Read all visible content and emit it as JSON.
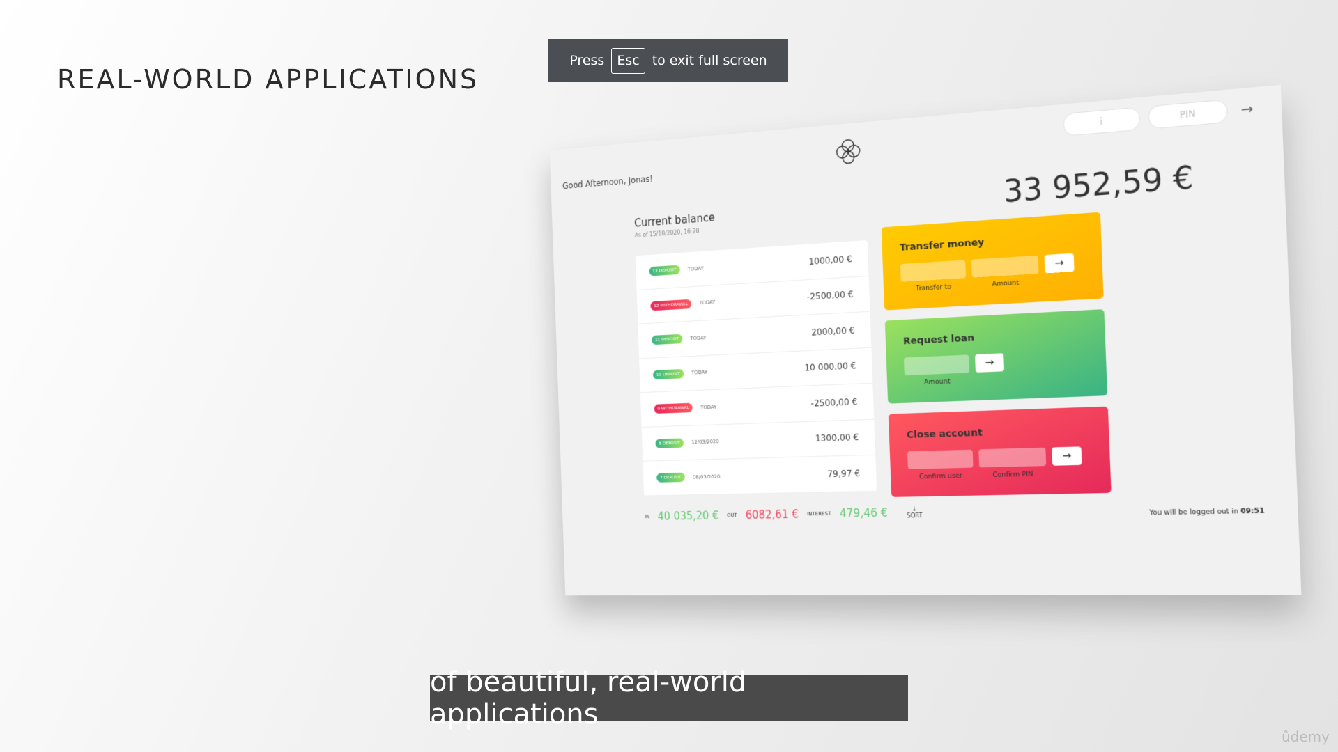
{
  "slide": {
    "title": "REAL-WORLD APPLICATIONS"
  },
  "fullscreen_notice": {
    "press": "Press",
    "key": "Esc",
    "rest": "to exit full screen"
  },
  "app": {
    "greeting": "Good Afternoon, Jonas!",
    "login": {
      "user_placeholder": "i",
      "pin_placeholder": "PIN",
      "arrow": "→"
    },
    "balance": {
      "label": "Current balance",
      "date": "As of 15/10/2020, 16:28",
      "value": "33 952,59 €"
    },
    "movements": [
      {
        "type": "deposit",
        "label": "13 DEPOSIT",
        "date": "TODAY",
        "value": "1000,00 €"
      },
      {
        "type": "withdrawal",
        "label": "12 WITHDRAWAL",
        "date": "TODAY",
        "value": "-2500,00 €"
      },
      {
        "type": "deposit",
        "label": "11 DEPOSIT",
        "date": "TODAY",
        "value": "2000,00 €"
      },
      {
        "type": "deposit",
        "label": "10 DEPOSIT",
        "date": "TODAY",
        "value": "10 000,00 €"
      },
      {
        "type": "withdrawal",
        "label": "9 WITHDRAWAL",
        "date": "TODAY",
        "value": "-2500,00 €"
      },
      {
        "type": "deposit",
        "label": "8 DEPOSIT",
        "date": "12/03/2020",
        "value": "1300,00 €"
      },
      {
        "type": "deposit",
        "label": "7 DEPOSIT",
        "date": "08/03/2020",
        "value": "79,97 €"
      }
    ],
    "transfer": {
      "title": "Transfer money",
      "label_to": "Transfer to",
      "label_amount": "Amount",
      "button": "→"
    },
    "loan": {
      "title": "Request loan",
      "label_amount": "Amount",
      "button": "→"
    },
    "close": {
      "title": "Close account",
      "label_user": "Confirm user",
      "label_pin": "Confirm PIN",
      "button": "→"
    },
    "summary": {
      "in_label": "IN",
      "in_value": "40 035,20 €",
      "out_label": "OUT",
      "out_value": "6082,61 €",
      "interest_label": "INTEREST",
      "interest_value": "479,46 €",
      "sort_arrow": "↓",
      "sort_label": "SORT"
    },
    "logout": {
      "text": "You will be logged out in",
      "timer": "09:51"
    }
  },
  "caption": "of beautiful, real-world applications",
  "watermark": "ûdemy"
}
